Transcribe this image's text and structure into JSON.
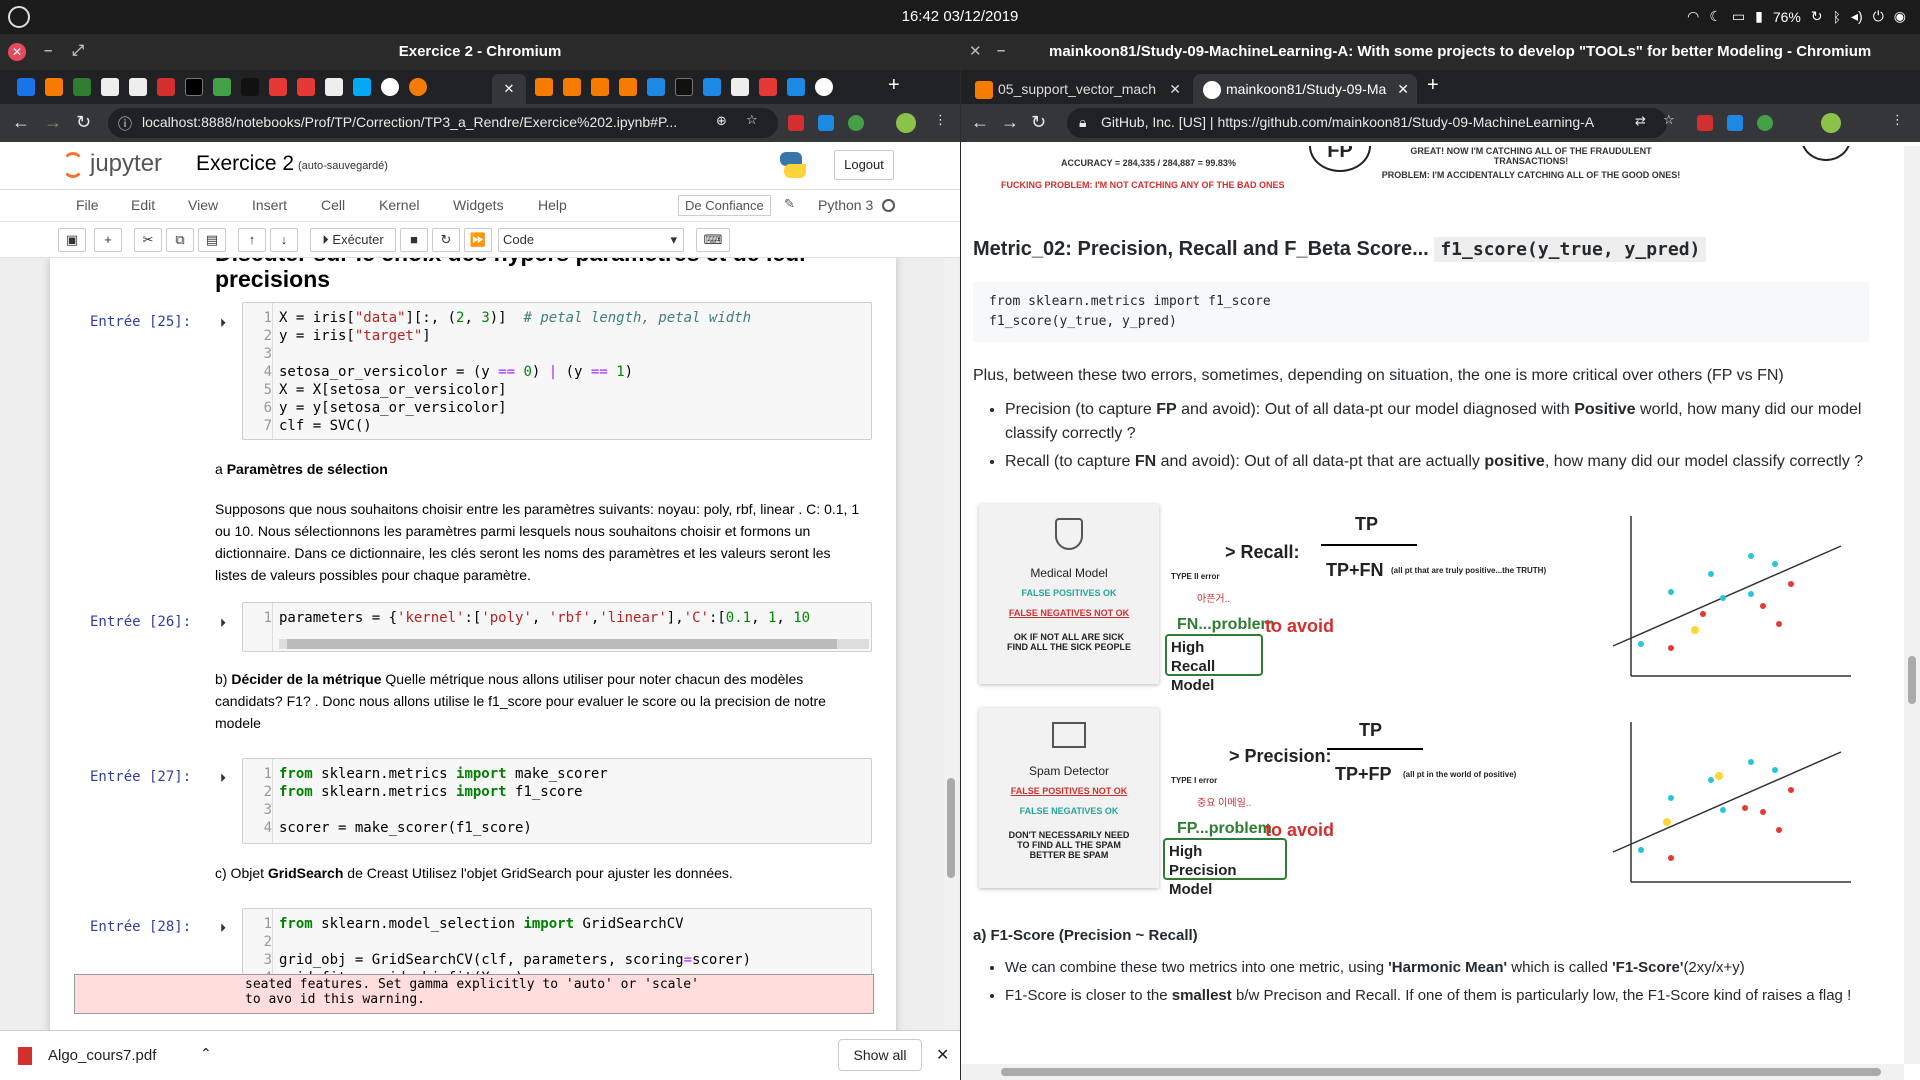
{
  "system": {
    "clock": "16:42 03/12/2019",
    "battery": "76%"
  },
  "left_window": {
    "title": "Exercice 2 - Chromium",
    "url": "localhost:8888/notebooks/Prof/TP/Correction/TP3_a_Rendre/Exercice%202.ipynb#P...",
    "jupyter": {
      "logo_text": "jupyter",
      "notebook_name": "Exercice 2",
      "autosave": "(auto-sauvegardé)",
      "logout": "Logout",
      "menu": [
        "File",
        "Edit",
        "View",
        "Insert",
        "Cell",
        "Kernel",
        "Widgets",
        "Help"
      ],
      "trusted": "De Confiance",
      "kernel": "Python 3",
      "run_label": "Exécuter",
      "cell_type": "Code"
    },
    "notebook": {
      "heading": "Discuter sur le choix des hypers paramètres et de leur precisions",
      "cell25_prompt": "Entrée [25]:",
      "cell26_prompt": "Entrée [26]:",
      "cell27_prompt": "Entrée [27]:",
      "cell28_prompt": "Entrée [28]:",
      "section_a_prefix": "a",
      "section_a_title": "Paramètres de sélection",
      "para1": "Supposons que nous souhaitons choisir entre les paramètres suivants: noyau: poly, rbf, linear . C: 0.1, 1 ou 10. Nous sélectionnons les paramètres parmi lesquels nous souhaitons choisir et formons un dictionnaire. Dans ce dictionnaire, les clés seront les noms des paramètres et les valeurs seront les listes de valeurs possibles pour chaque paramètre.",
      "section_b_prefix": "b)",
      "section_b_title": "Décider de la métrique",
      "section_b_text": "Quelle métrique nous allons utiliser pour noter chacun des modèles candidats? F1? . Donc nous allons utilise le f1_score pour evaluer le score ou la precision de notre modele",
      "section_c_prefix": "c) Objet",
      "section_c_title": "GridSearch",
      "section_c_text": "de Creast Utilisez l'objet GridSearch pour ajuster les données.",
      "warning": "seated features. Set gamma explicitly to 'auto' or 'scale' to avo id this warning."
    },
    "download": {
      "file": "Algo_cours7.pdf",
      "show_all": "Show all"
    }
  },
  "right_window": {
    "title": "mainkoon81/Study-09-MachineLearning-A: With some projects to develop \"TOOLs\" for better Modeling - Chromium",
    "tabs": [
      "05_support_vector_mach",
      "mainkoon81/Study-09-Ma"
    ],
    "site_label": "GitHub, Inc. [US]",
    "url": "https://github.com/mainkoon81/Study-09-MachineLearning-A",
    "top_image": {
      "accuracy": "ACCURACY = 284,335 / 284,887 = 99.83%",
      "problem": "FUCKING PROBLEM: I'M NOT CATCHING ANY OF THE BAD ONES",
      "right_text1": "GREAT! NOW I'M CATCHING ALL OF THE FRAUDULENT TRANSACTIONS!",
      "right_text2": "PROBLEM: I'M ACCIDENTALLY CATCHING ALL OF THE GOOD ONES!"
    },
    "heading": "Metric_02: Precision, Recall and F_Beta Score...",
    "heading_code": "f1_score(y_true, y_pred)",
    "code_line1": "from sklearn.metrics import f1_score",
    "code_line2": "f1_score(y_true, y_pred)",
    "para1": "Plus, between these two errors, sometimes, depending on situation, the one is more critical over others (FP vs FN)",
    "bullet1_a": "Precision (to capture ",
    "bullet1_b": "FP",
    "bullet1_c": " and avoid): Out of all data-pt our model diagnosed with ",
    "bullet1_d": "Positive",
    "bullet1_e": " world, how many did our model classify correctly ?",
    "bullet2_a": "Recall (to capture ",
    "bullet2_b": "FN",
    "bullet2_c": " and avoid): Out of all data-pt that are actually ",
    "bullet2_d": "positive",
    "bullet2_e": ", how many did our model classify correctly ?",
    "recall_card": {
      "title": "Medical Model",
      "l1": "FALSE POSITIVES OK",
      "l2": "FALSE NEGATIVES NOT OK",
      "l3": "OK IF NOT ALL ARE SICK",
      "l4": "FIND ALL THE SICK PEOPLE"
    },
    "recall_formula": {
      "label": "> Recall:",
      "num": "TP",
      "den": "TP+FN",
      "note": "(all pt that are truly positive...the TRUTH)",
      "type": "TYPE II error",
      "kr": "아픈거..",
      "problem": "FN...problem",
      "avoid": "to avoid",
      "high": "High",
      "model": "Recall Model"
    },
    "precision_card": {
      "title": "Spam Detector",
      "l1": "FALSE POSITIVES NOT OK",
      "l2": "FALSE NEGATIVES OK",
      "l3": "DON'T NECESSARILY NEED",
      "l4": "TO FIND ALL THE SPAM",
      "l5": "BETTER BE SPAM"
    },
    "precision_formula": {
      "label": "> Precision:",
      "num": "TP",
      "den": "TP+FP",
      "note": "(all pt in the world of positive)",
      "type": "TYPE I error",
      "kr": "중요 이메일..",
      "problem": "FP...problem",
      "avoid": "to avoid",
      "high": "High",
      "model": "Precision Model"
    },
    "sub_heading": "a) F1-Score (Precision ~ Recall)",
    "b3_a": "We can combine these two metrics into one metric, using ",
    "b3_b": "'Harmonic Mean'",
    "b3_c": " which is called ",
    "b3_d": "'F1-Score'",
    "b3_e": "(2xy/x+y)",
    "b4_a": "F1-Score is closer to the ",
    "b4_b": "smallest",
    "b4_c": " b/w Precison and Recall. If one of them is particularly low, the F1-Score kind of raises a flag !"
  }
}
